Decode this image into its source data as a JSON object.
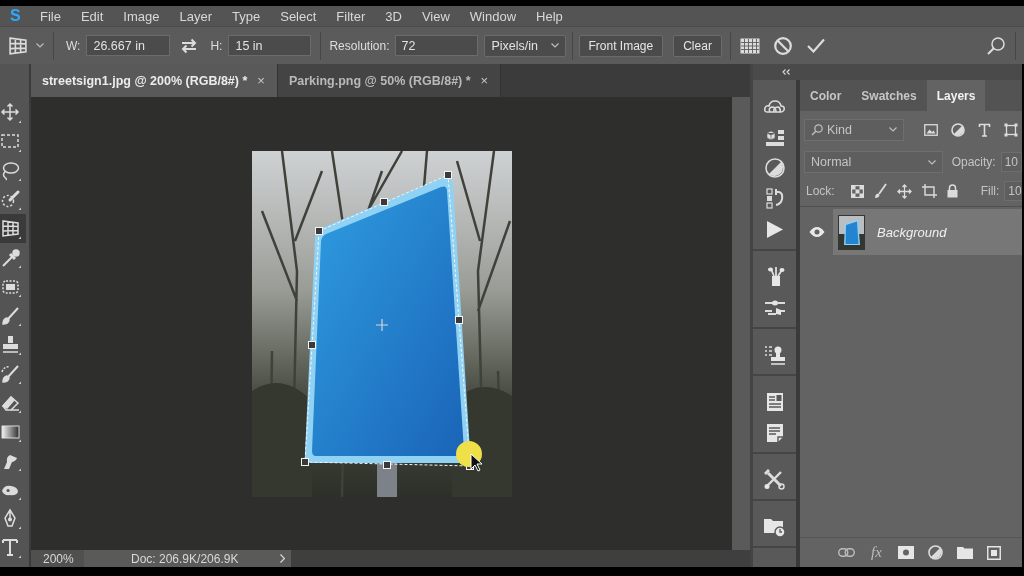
{
  "logo": "S",
  "menu": [
    "File",
    "Edit",
    "Image",
    "Layer",
    "Type",
    "Select",
    "Filter",
    "3D",
    "View",
    "Window",
    "Help"
  ],
  "options_bar": {
    "width_label": "W:",
    "width_value": "26.667 in",
    "height_label": "H:",
    "height_value": "15 in",
    "resolution_label": "Resolution:",
    "resolution_value": "72",
    "unit": "Pixels/in",
    "buttons": [
      "Front Image",
      "Clear"
    ]
  },
  "tools": [
    {
      "kind": "move",
      "selected": false
    },
    {
      "kind": "marquee",
      "selected": false
    },
    {
      "kind": "lasso",
      "selected": false
    },
    {
      "kind": "quick-select",
      "selected": false
    },
    {
      "kind": "perspective-crop",
      "selected": true
    },
    {
      "kind": "eyedropper",
      "selected": false
    },
    {
      "kind": "patch",
      "selected": false
    },
    {
      "kind": "brush",
      "selected": false
    },
    {
      "kind": "stamp",
      "selected": false
    },
    {
      "kind": "history-brush",
      "selected": false
    },
    {
      "kind": "eraser",
      "selected": false
    },
    {
      "kind": "gradient",
      "selected": false
    },
    {
      "kind": "smudge",
      "selected": false
    },
    {
      "kind": "sponge",
      "selected": false
    },
    {
      "kind": "pen",
      "selected": false
    },
    {
      "kind": "type",
      "selected": false
    }
  ],
  "tabs": [
    {
      "label": "streetsign1.jpg @ 200% (RGB/8#) *",
      "close": "×",
      "selected": true
    },
    {
      "label": "Parking.png @ 50% (RGB/8#) *",
      "close": "×",
      "selected": false
    }
  ],
  "status_bar": {
    "zoom": "200%",
    "doc": "Doc: 206.9K/206.9K"
  },
  "panel": {
    "tabs": [
      {
        "label": "Color",
        "selected": false
      },
      {
        "label": "Swatches",
        "selected": false
      },
      {
        "label": "Layers",
        "selected": true
      }
    ],
    "filter": "Kind",
    "blend_mode": "Normal",
    "opacity_label": "Opacity:",
    "opacity_value": "10",
    "lock_label": "Lock:",
    "fill_label": "Fill:",
    "fill_value": "10",
    "layers": [
      {
        "name": "Background",
        "visible": true,
        "selected": true
      }
    ],
    "fx": "fx"
  }
}
